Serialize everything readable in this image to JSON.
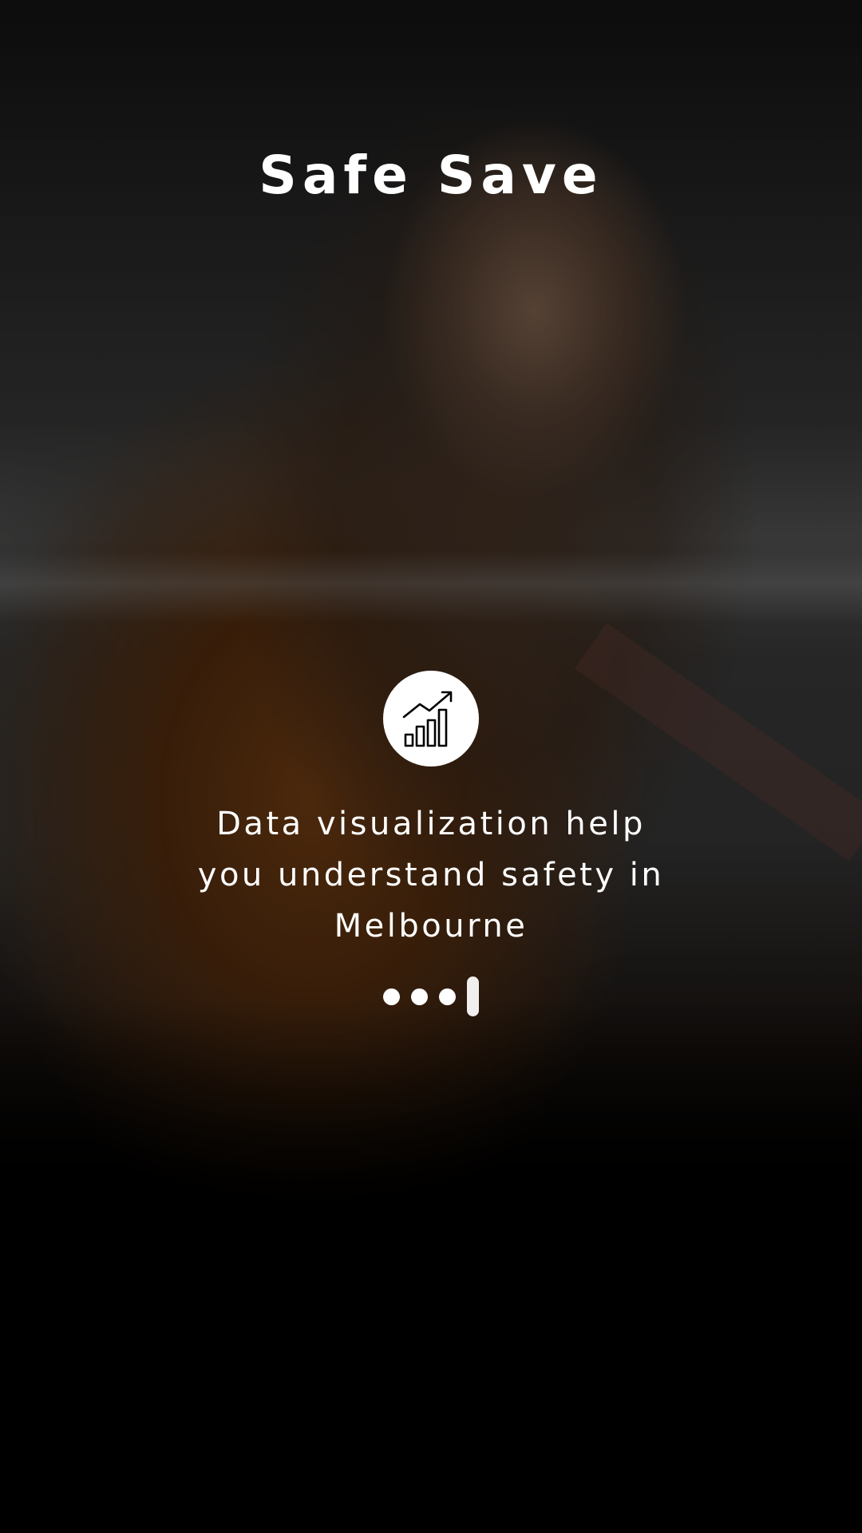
{
  "app": {
    "title": "Safe Save"
  },
  "slide": {
    "icon": "chart-growth-icon",
    "caption": "Data visualization help you understand safety in Melbourne"
  },
  "pager": {
    "total": 4,
    "current": 4
  },
  "colors": {
    "text": "#ffffff",
    "icon_bg": "#ffffff",
    "active_indicator": "#f1eeee"
  }
}
